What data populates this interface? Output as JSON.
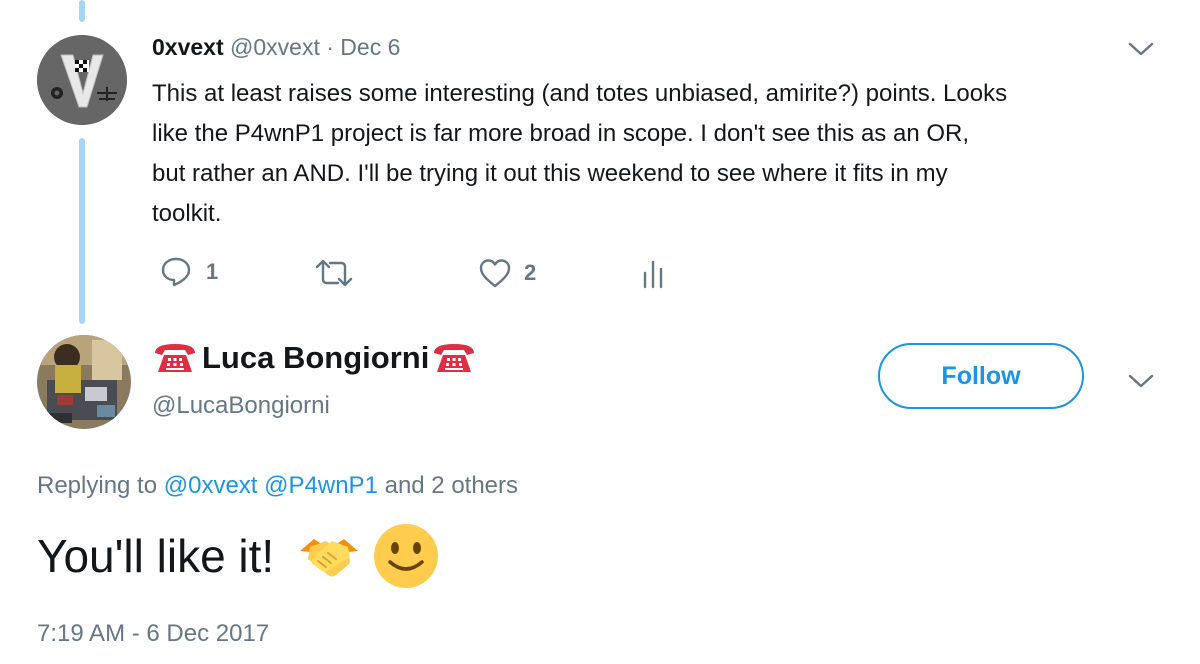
{
  "parent_tweet": {
    "author_name": "0xvext",
    "handle": "@0xvext",
    "separator": "·",
    "date": "Dec 6",
    "text_lines": [
      "This at least raises some interesting (and totes unbiased, amirite?) points. Looks",
      "like the P4wnP1 project is far more broad in scope. I don't see this as an OR,",
      "but rather an AND. I'll be trying it out this weekend to see where it fits in my",
      "toolkit."
    ],
    "actions": {
      "reply_count": "1",
      "retweet_count": "",
      "like_count": "2"
    },
    "avatar_icon": "v-logo-avatar"
  },
  "main_tweet": {
    "author_name": "Luca Bongiorni",
    "name_emoji": "telephone",
    "handle": "@LucaBongiorni",
    "follow_label": "Follow",
    "replying_prefix": "Replying to",
    "replying_mentions": [
      "@0xvext",
      "@P4wnP1"
    ],
    "replying_suffix": "and 2 others",
    "text": "You'll like it!",
    "text_emojis": [
      "handshake",
      "slightly-smiling-face"
    ],
    "timestamp": "7:19 AM - 6 Dec 2017"
  },
  "colors": {
    "accent": "#1b95e0",
    "thread_line": "#a6d6f4",
    "secondary_text": "#657786",
    "phone_emoji": "#dd2e44",
    "emoji_yellow": "#ffcc4d"
  }
}
